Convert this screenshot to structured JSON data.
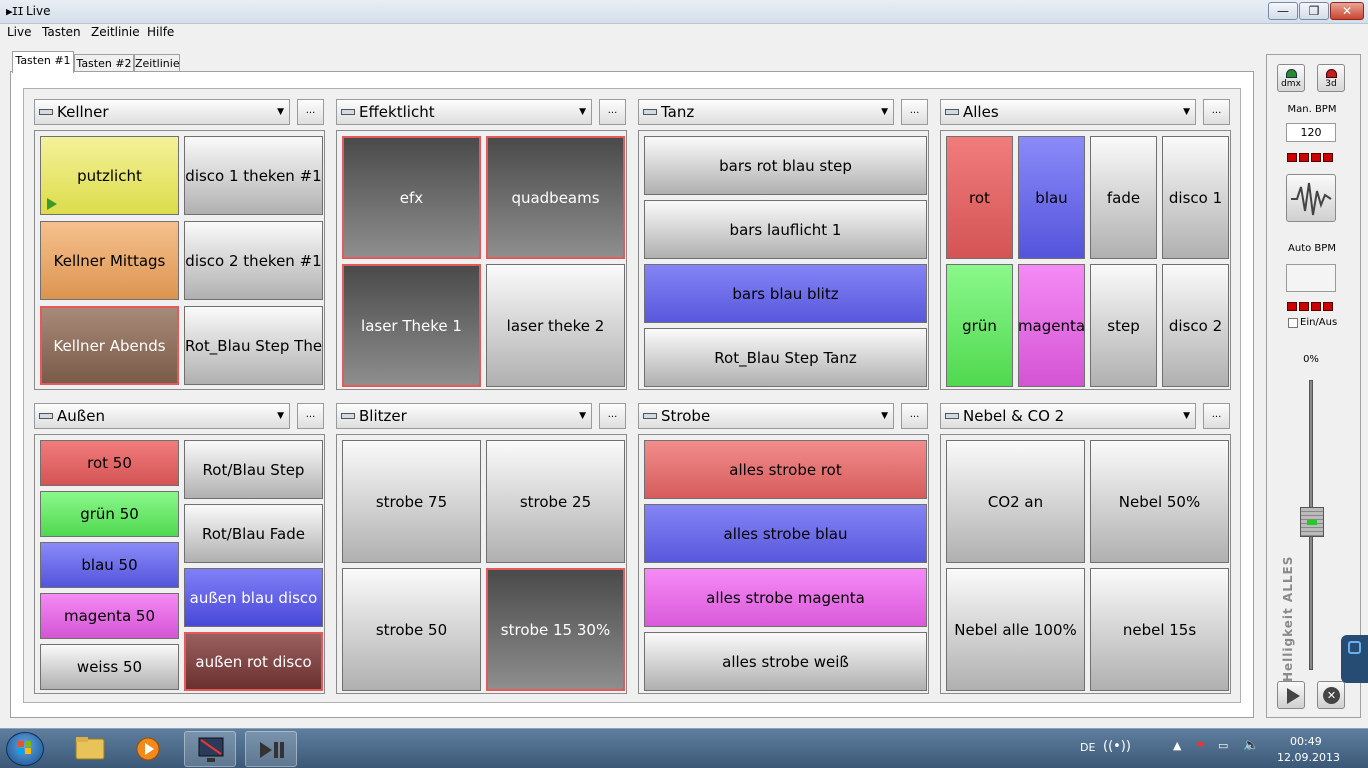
{
  "window": {
    "title": "Live",
    "app_icon": "▶II",
    "btn_min": "—",
    "btn_max": "❐",
    "btn_close": "✕"
  },
  "menu": [
    "Live",
    "Tasten",
    "Zeitlinie",
    "Hilfe"
  ],
  "tabs": [
    "Tasten #1",
    "Tasten #2",
    "Zeitlinie"
  ],
  "panels": [
    {
      "title": "Kellner",
      "more": "...",
      "buttons": [
        "putzlicht",
        "disco 1 theken #1",
        "Kellner Mittags",
        "disco 2 theken #1",
        "Kellner Abends",
        "Rot_Blau Step Theke"
      ]
    },
    {
      "title": "Effektlicht",
      "more": "...",
      "buttons": [
        "efx",
        "quadbeams",
        "laser Theke 1",
        "laser theke 2"
      ]
    },
    {
      "title": "Tanz",
      "more": "...",
      "buttons": [
        "bars rot blau step",
        "bars lauflicht 1",
        "bars blau blitz",
        "Rot_Blau Step Tanz"
      ]
    },
    {
      "title": "Alles",
      "more": "...",
      "buttons": [
        "rot",
        "blau",
        "fade",
        "disco 1",
        "grün",
        "magenta",
        "step",
        "disco 2"
      ]
    },
    {
      "title": "Außen",
      "more": "...",
      "buttons": [
        "rot 50",
        "grün 50",
        "blau 50",
        "magenta 50",
        "weiss 50",
        "Rot/Blau Step",
        "Rot/Blau Fade",
        "außen blau disco",
        "außen rot disco"
      ]
    },
    {
      "title": "Blitzer",
      "more": "...",
      "buttons": [
        "strobe 75",
        "strobe  25",
        "strobe  50",
        "strobe 15 30%"
      ]
    },
    {
      "title": "Strobe",
      "more": "...",
      "buttons": [
        "alles strobe rot",
        "alles strobe blau",
        "alles strobe magenta",
        "alles strobe weiß"
      ]
    },
    {
      "title": "Nebel & CO 2",
      "more": "...",
      "buttons": [
        "CO2 an",
        "Nebel 50%",
        "Nebel alle 100%",
        "nebel 15s"
      ]
    }
  ],
  "side": {
    "dmx_label": "dmx",
    "d3_label": "3d",
    "man_bpm_label": "Man. BPM",
    "man_bpm_value": "120",
    "auto_bpm_label": "Auto BPM",
    "ein_aus_label": "Ein/Aus",
    "brightness_value": "0%",
    "brightness_label": "Helligkeit ALLES",
    "brightness_level": 0
  },
  "taskbar": {
    "lang": "DE",
    "time": "00:49",
    "date": "12.09.2013"
  },
  "colors": {
    "red": "#d45454",
    "blue": "#5454dc",
    "green": "#50d850",
    "magenta": "#d454d4",
    "yellow": "#dcdc4a",
    "orange": "#dc9550",
    "selected_border": "#e45a5a"
  }
}
